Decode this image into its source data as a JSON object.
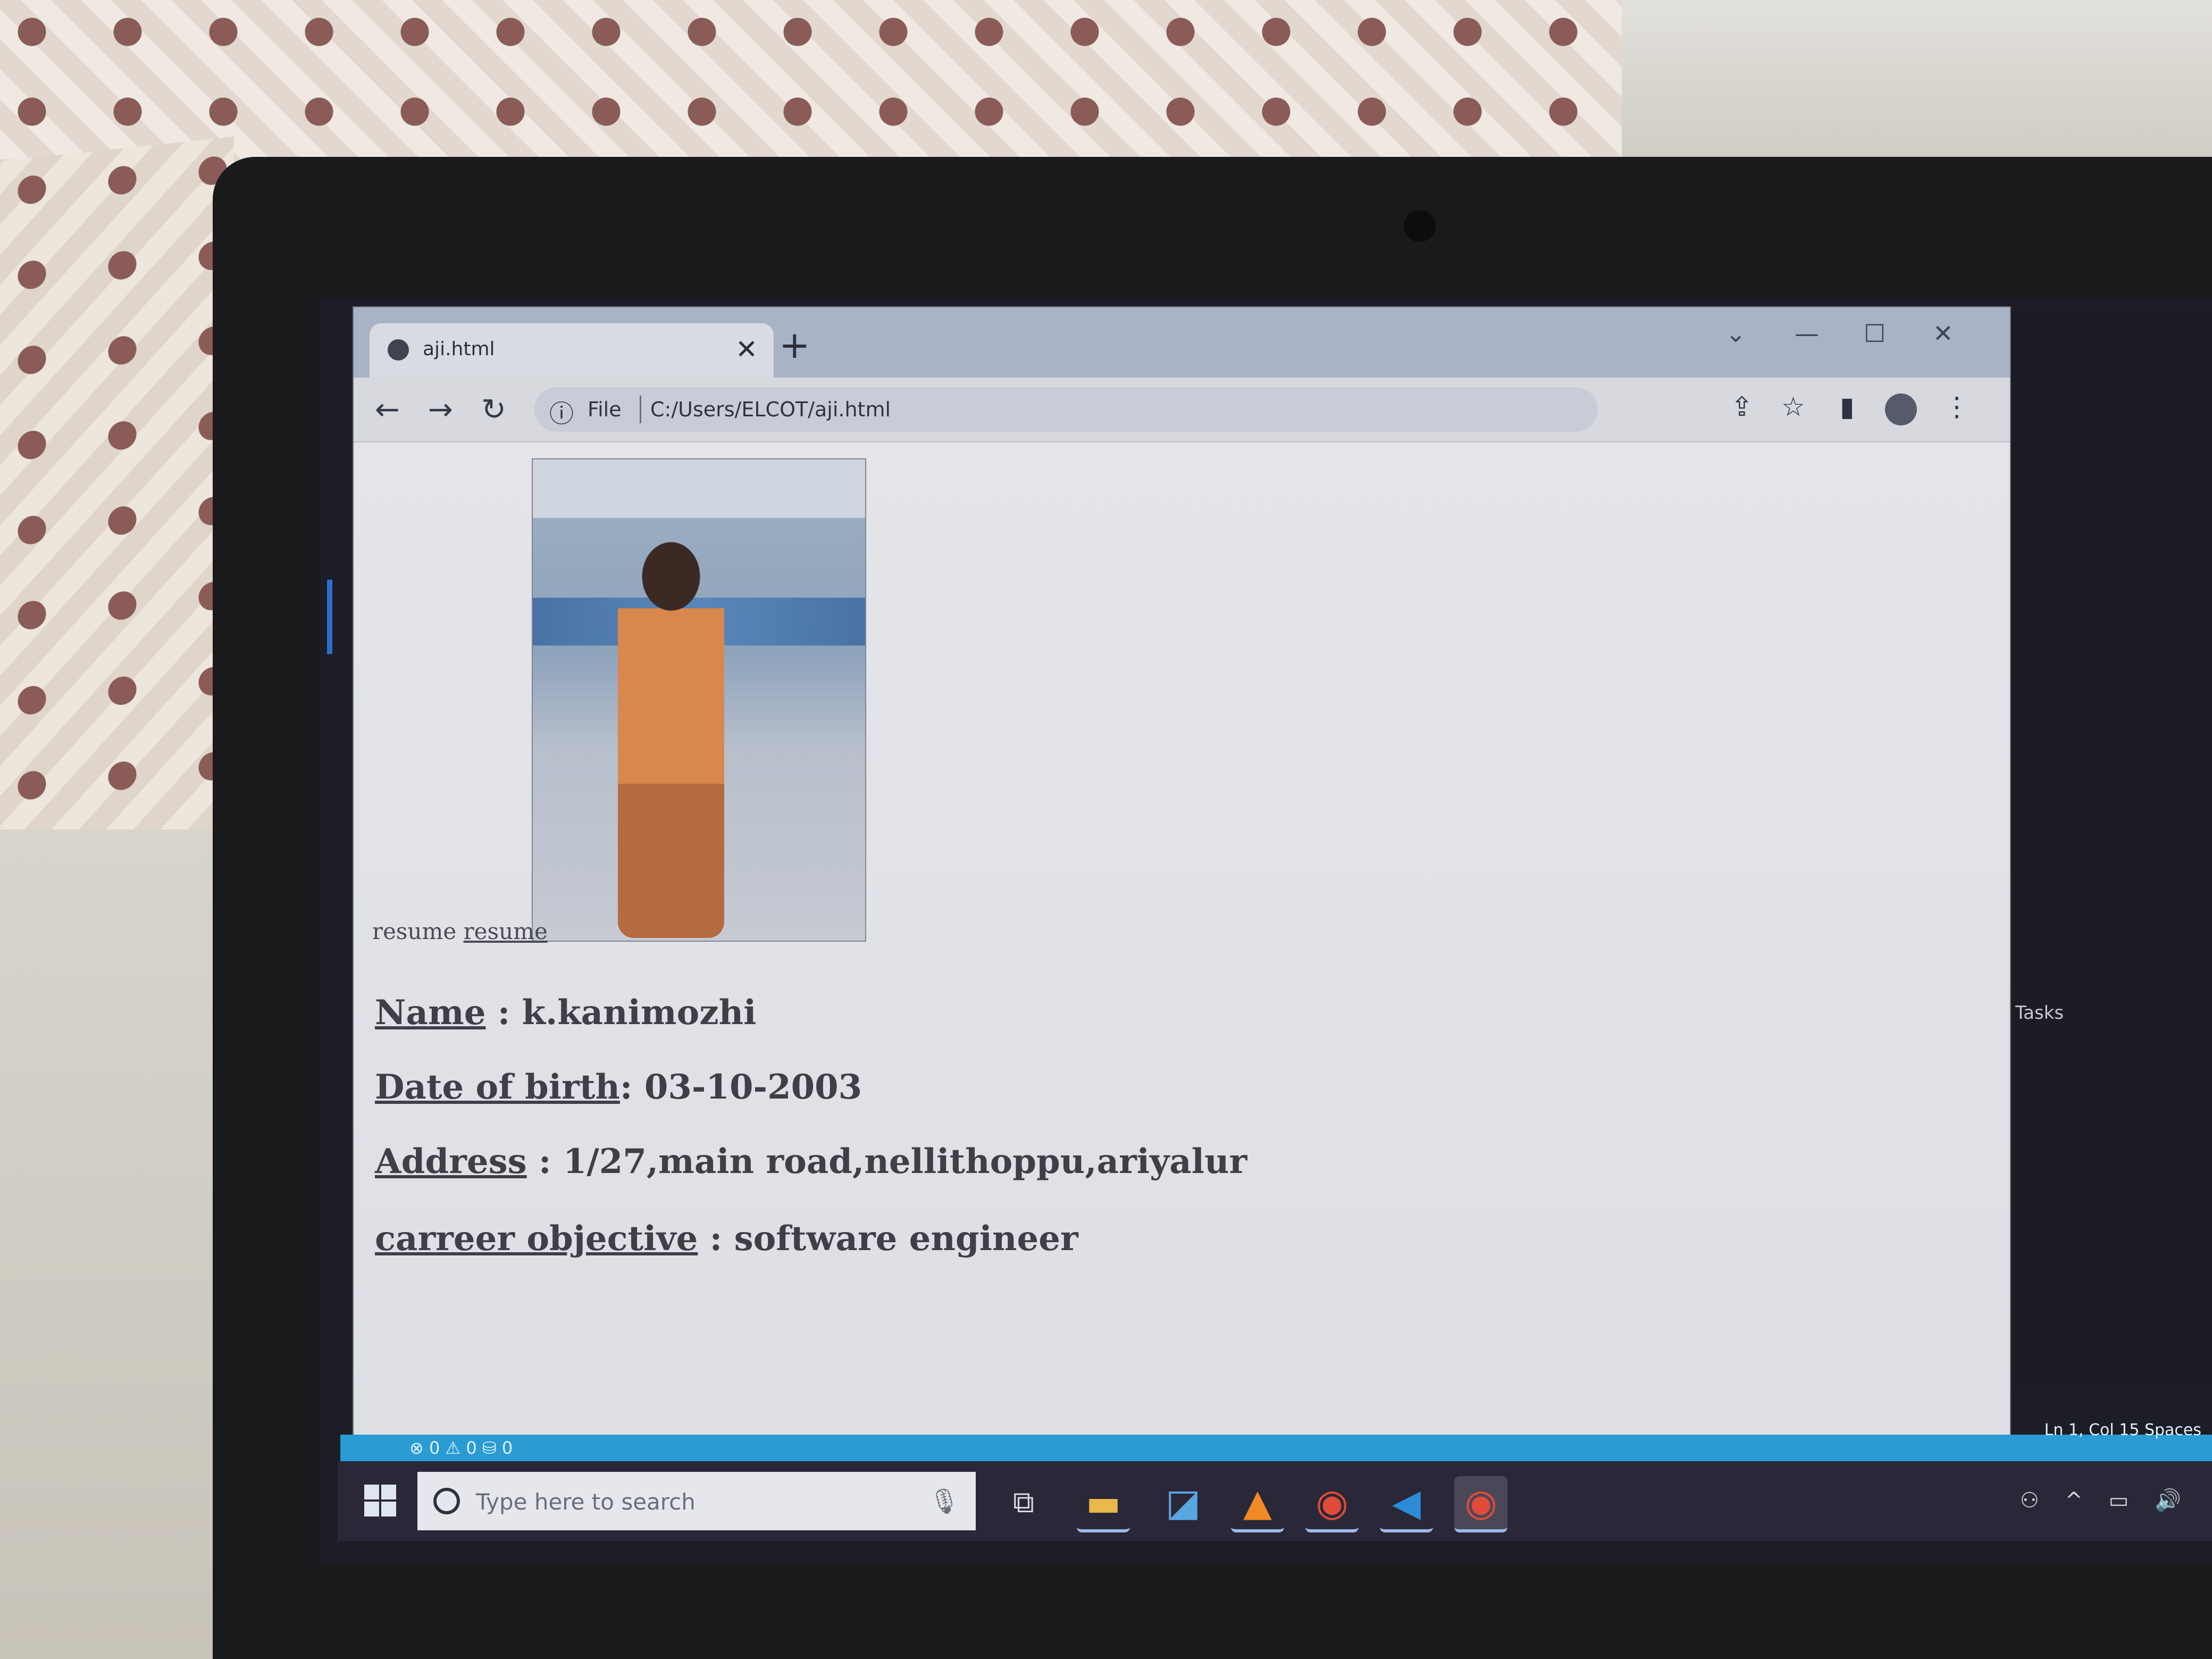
{
  "browser": {
    "tab_title": "aji.html",
    "tab_close_icon": "✕",
    "new_tab_icon": "+",
    "window_controls": {
      "menu": "⌄",
      "minimize": "—",
      "maximize": "☐",
      "close": "✕"
    },
    "nav": {
      "back": "←",
      "forward": "→",
      "reload": "↻"
    },
    "address": {
      "info_icon": "ⓘ",
      "scheme_label": "File",
      "url": "C:/Users/ELCOT/aji.html"
    },
    "toolbar_icons": {
      "share": "⇪",
      "bookmark": "☆",
      "side_panel": "▮",
      "menu": "⋮"
    }
  },
  "page": {
    "resume_text": "resume",
    "resume_link": "resume",
    "fields": [
      {
        "label": "Name",
        "separator": " : ",
        "value": "k.kanimozhi"
      },
      {
        "label": "Date of birth",
        "separator": ": ",
        "value": "03-10-2003"
      },
      {
        "label": "Address",
        "separator": " : ",
        "value": "1/27,main road,nellithoppu,ariyalur"
      },
      {
        "label": "carreer objective",
        "separator": " : ",
        "value": "software engineer"
      }
    ]
  },
  "editor_side": {
    "tasks_label": "Tasks",
    "status_left": "⊗ 0 ⚠ 0   ⛁ 0",
    "status_right": "Ln 1, Col 15   Spaces"
  },
  "taskbar": {
    "search_placeholder": "Type here to search",
    "mic_icon": "🎙",
    "task_view_icon": "⧉",
    "apps": [
      {
        "name": "file-explorer",
        "glyph": "▬",
        "color": "#e8b84a"
      },
      {
        "name": "vs-studio",
        "glyph": "◪",
        "color": "#58a7e0"
      },
      {
        "name": "vlc",
        "glyph": "▲",
        "color": "#f08a24"
      },
      {
        "name": "chrome",
        "glyph": "◉",
        "color": "#e04b3a"
      },
      {
        "name": "vscode",
        "glyph": "◀",
        "color": "#2e8bd8"
      },
      {
        "name": "chrome-active",
        "glyph": "◉",
        "color": "#e04b3a"
      }
    ],
    "tray_icons": "⚇ ^ ▭ 🔊"
  }
}
